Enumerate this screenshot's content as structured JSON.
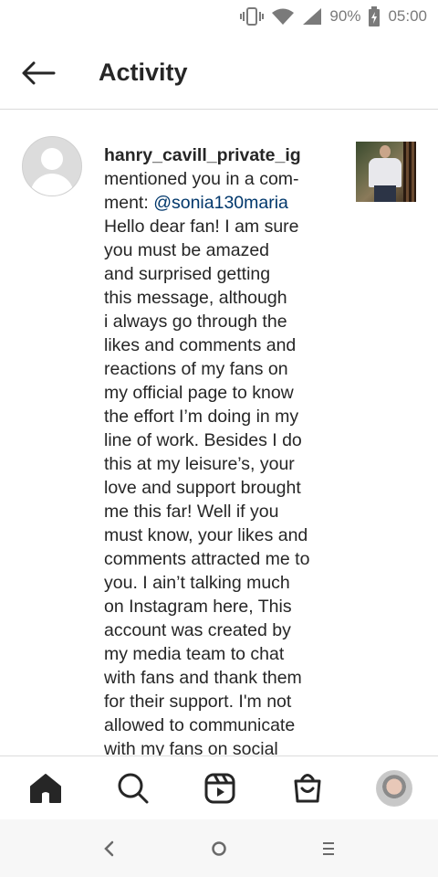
{
  "status_bar": {
    "battery_percent": "90%",
    "time": "05:00",
    "icons": [
      "vibrate-icon",
      "wifi-icon",
      "cellular-signal-icon",
      "battery-charging-icon"
    ]
  },
  "header": {
    "back_icon": "back-arrow-icon",
    "title": "Activity"
  },
  "activity": {
    "username": "hanry_cavill_private_ig",
    "action_lines": [
      "mentioned you in a com-",
      "ment: "
    ],
    "mention": "@sonia130maria",
    "comment_lines": [
      "Hello dear fan!  I am sure",
      "you must be amazed",
      "and surprised getting",
      "this message, although",
      "i always go through the",
      "likes and comments and",
      "reactions of my fans on",
      "my official page to know",
      "the effort I’m doing in my",
      "line of work.  Besides I do",
      "this at my leisure’s, your",
      "love and support brought",
      "me this far!  Well if you",
      "must know, your likes and",
      "comments attracted me to",
      "you.  I ain’t talking much",
      "on Instagram here, This",
      "account was created by",
      "my media team to chat",
      "with fans and thank them",
      "for their support.  I'm not",
      "allowed to communicate",
      "with my fans on social"
    ],
    "avatar_icon": "default-avatar-icon",
    "thumbnail": "post-thumbnail"
  },
  "bottom_nav": {
    "items": [
      "home-icon",
      "search-icon",
      "reels-icon",
      "shop-icon",
      "profile-avatar"
    ],
    "active": "home-icon"
  },
  "system_nav": {
    "items": [
      "back-icon",
      "home-circle-icon",
      "recents-icon"
    ]
  },
  "colors": {
    "text": "#262626",
    "mention": "#00376b",
    "divider": "#dbdbdb",
    "status_icons": "#7a7a7a"
  }
}
